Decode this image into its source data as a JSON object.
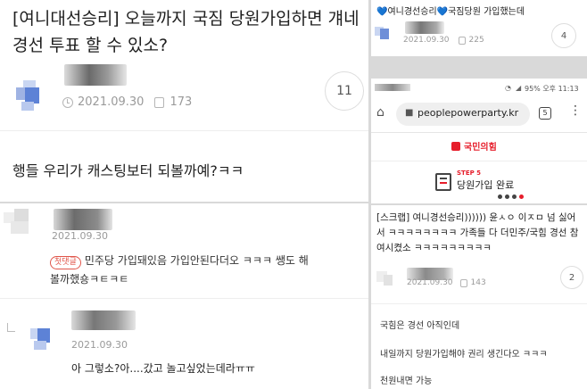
{
  "left_post": {
    "title": "[여니대선승리] 오늘까지 국짐 당원가입하면 걔네 경선 투표 할 수 있소?",
    "date": "2021.09.30",
    "views": "173",
    "comment_count": "11",
    "body": "행들 우리가 캐스팅보터 되볼까예?ㅋㅋ"
  },
  "left_comments": {
    "comment1": {
      "date": "2021.09.30",
      "badge": "첫댓글",
      "text": "민주당 가입돼있음 가입안된다더오 ㅋㅋㅋ 쌩도 해볼까했숑ㅋㅌㅋㅌ"
    },
    "reply1": {
      "date": "2021.09.30",
      "text": "아 그렇소?아....갔고 놀고싶었는데라ㅠㅠ"
    }
  },
  "right_top": {
    "title": "💙여니경선승리💙국짐당원 가입했는데",
    "date": "2021.09.30",
    "views": "225",
    "comment_count": "4"
  },
  "phone": {
    "status_text": "95% 오후 11:13",
    "url": "peoplepowerparty.kr",
    "tab_count": "5",
    "party_logo_text": "국민의힘",
    "step_label": "STEP 5",
    "step_title": "당원가입 완료"
  },
  "right_post": {
    "title": "[스크랩] 여니경선승리)))))) 윤ㅅㅇ 이ㅈㅁ 넘 싫어서 ㅋㅋㅋㅋㅋㅋㅋㅋ 가족들 다 더민주/국힘 경선 참여시켰소 ㅋㅋㅋㅋㅋㅋㅋㅋㅋ",
    "date": "2021.09.30",
    "views": "143",
    "comment_count": "2",
    "line1": "국힘은 경선 아직인데",
    "line2": "내일까지 당원가입해야 권리 생긴다오 ㅋㅋㅋ",
    "line3": "천원내면 가능"
  },
  "colors": {
    "party_red": "#e61e2b",
    "avatar_blue": "#6f8fd8",
    "badge_red": "#e0554a",
    "heart_blue": "#3aa0e8"
  }
}
